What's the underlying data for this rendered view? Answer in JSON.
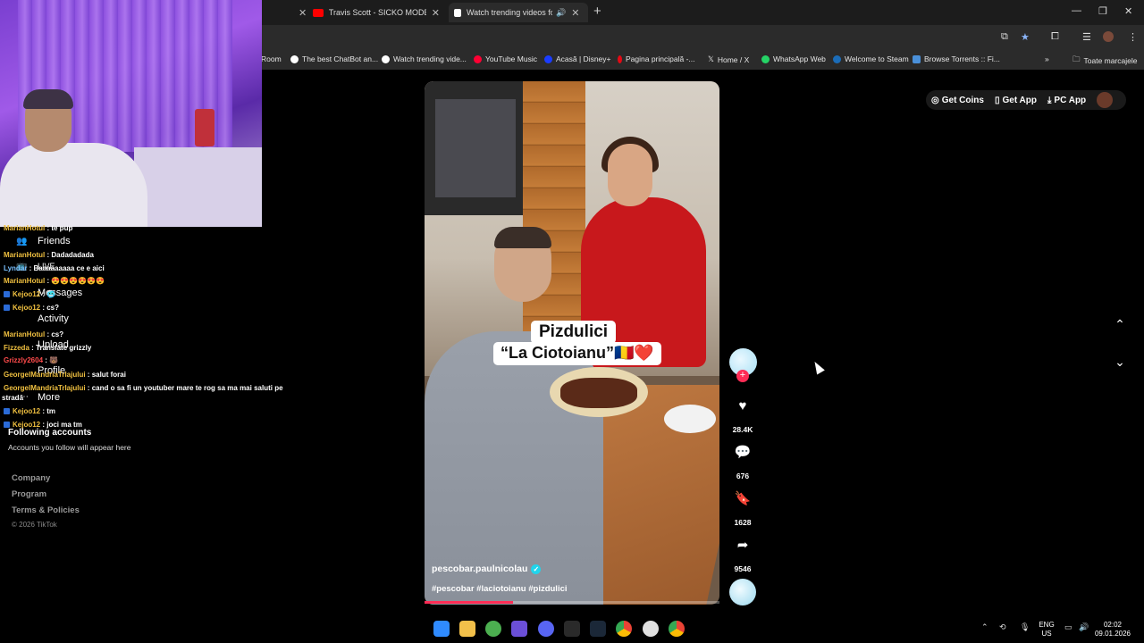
{
  "browser": {
    "tabs": [
      {
        "title": "Travis Scott - SICKO MODE (Offi",
        "icon_color": "#ff0000",
        "active": false
      },
      {
        "title": "Watch trending videos for y",
        "icon_color": "#ffffff",
        "active": true
      }
    ],
    "bookmarks": [
      {
        "label": "Room",
        "icon_color": "#888888"
      },
      {
        "label": "The best ChatBot an...",
        "icon_color": "#ffffff"
      },
      {
        "label": "Watch trending vide...",
        "icon_color": "#ffffff"
      },
      {
        "label": "YouTube Music",
        "icon_color": "#ff0033"
      },
      {
        "label": "Acasă | Disney+",
        "icon_color": "#1a3cff"
      },
      {
        "label": "Pagina principală -...",
        "icon_color": "#e50914"
      },
      {
        "label": "Home / X",
        "icon_color": "#ffffff"
      },
      {
        "label": "WhatsApp Web",
        "icon_color": "#25d366"
      },
      {
        "label": "Welcome to Steam",
        "icon_color": "#1b6cb8"
      },
      {
        "label": "Browse Torrents :: Fi...",
        "icon_color": "#4a90d9"
      }
    ],
    "bookmarks_folder": "Toate marcajele"
  },
  "header_actions": {
    "get_coins": "Get Coins",
    "get_app": "Get App",
    "pc_app": "PC App"
  },
  "sidebar": {
    "nav": [
      {
        "label": "Friends"
      },
      {
        "label": "LIVE"
      },
      {
        "label": "Messages"
      },
      {
        "label": "Activity"
      },
      {
        "label": "Upload"
      },
      {
        "label": "Profile"
      },
      {
        "label": "More"
      }
    ],
    "following_title": "Following accounts",
    "following_sub": "Accounts you follow will appear here",
    "footer": [
      "Company",
      "Program",
      "Terms & Policies"
    ],
    "copyright": "© 2026 TikTok"
  },
  "chat": [
    {
      "user": "MarianHotul",
      "msg": "te pup",
      "color": "yellow"
    },
    {
      "user": "MarianHotul",
      "msg": "Dadadadada",
      "color": "yellow"
    },
    {
      "user": "Lyndar",
      "msg": "Baaaaaaaaa ce e aici",
      "color": "blue"
    },
    {
      "user": "MarianHotul",
      "msg": "😍😍😍😍😍😍",
      "color": "yellow"
    },
    {
      "user": "Kejoo12",
      "msg": "🥶",
      "color": "yellow",
      "badge": true
    },
    {
      "user": "Kejoo12",
      "msg": "cs?",
      "color": "yellow",
      "badge": true
    },
    {
      "user": "MarianHotul",
      "msg": "cs?",
      "color": "yellow"
    },
    {
      "user": "Fizzeda",
      "msg": "Translate grizzly",
      "color": "yellow"
    },
    {
      "user": "Grizzly2604",
      "msg": "🐻",
      "color": "red"
    },
    {
      "user": "GeorgelMandriaTrlajului",
      "msg": "salut forai",
      "color": "yellow"
    },
    {
      "user": "GeorgelMandriaTrlajului",
      "msg": "cand o sa fi un youtuber mare te rog sa ma mai saluti pe",
      "color": "yellow"
    },
    {
      "user": "",
      "msg": "stradă",
      "color": "yellow"
    },
    {
      "user": "Kejoo12",
      "msg": "tm",
      "color": "yellow",
      "badge": true
    },
    {
      "user": "Kejoo12",
      "msg": "joci ma tm",
      "color": "yellow",
      "badge": true
    }
  ],
  "video": {
    "caption_line1": "Pizdulici",
    "caption_line2": "“La Ciotoianu”🇷🇴❤️",
    "author": "pescobar.paulnicolau",
    "hashtags": "#pescobar #laciotoianu #pizdulici",
    "progress": 0.3
  },
  "actions": {
    "likes": "28.4K",
    "comments": "676",
    "saves": "1628",
    "shares": "9546"
  },
  "taskbar": {
    "lang_line1": "ENG",
    "lang_line2": "US",
    "time": "02:02",
    "date": "09.01.2026"
  }
}
